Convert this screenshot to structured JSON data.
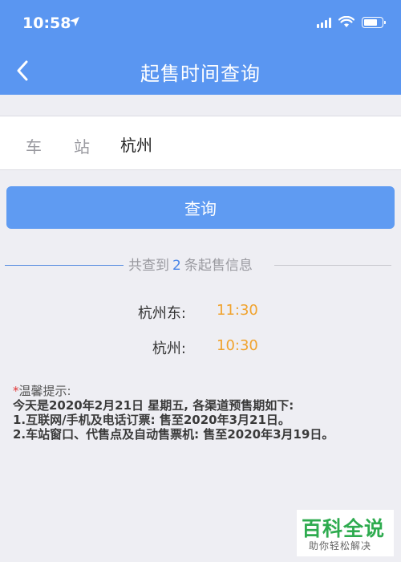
{
  "status_bar": {
    "time": "10:58"
  },
  "nav": {
    "title": "起售时间查询"
  },
  "form": {
    "station_label": "车站",
    "station_value": "杭州"
  },
  "query_button": {
    "label": "查询"
  },
  "result_summary": {
    "prefix": "共查到",
    "count": "2",
    "suffix": "条起售信息"
  },
  "results": [
    {
      "station": "杭州东:",
      "time": "11:30"
    },
    {
      "station": "杭州:",
      "time": "10:30"
    }
  ],
  "tips": {
    "marker": "*",
    "title": "温馨提示:",
    "lines": [
      "今天是2020年2月21日 星期五, 各渠道预售期如下:",
      "1.互联网/手机及电话订票: 售至2020年3月21日。",
      "2.车站窗口、代售点及自动售票机: 售至2020年3月19日。"
    ]
  },
  "watermark": {
    "title": "百科全说",
    "subtitle": "助你轻松解决"
  },
  "colors": {
    "header": "#5a96f1",
    "button": "#5f9bf2",
    "accent_time": "#f0a32e",
    "count": "#4a86e8",
    "watermark": "#2eab4f"
  },
  "icons": [
    "location-arrow-icon",
    "signal-icon",
    "wifi-icon",
    "battery-icon",
    "back-arrow-icon"
  ]
}
